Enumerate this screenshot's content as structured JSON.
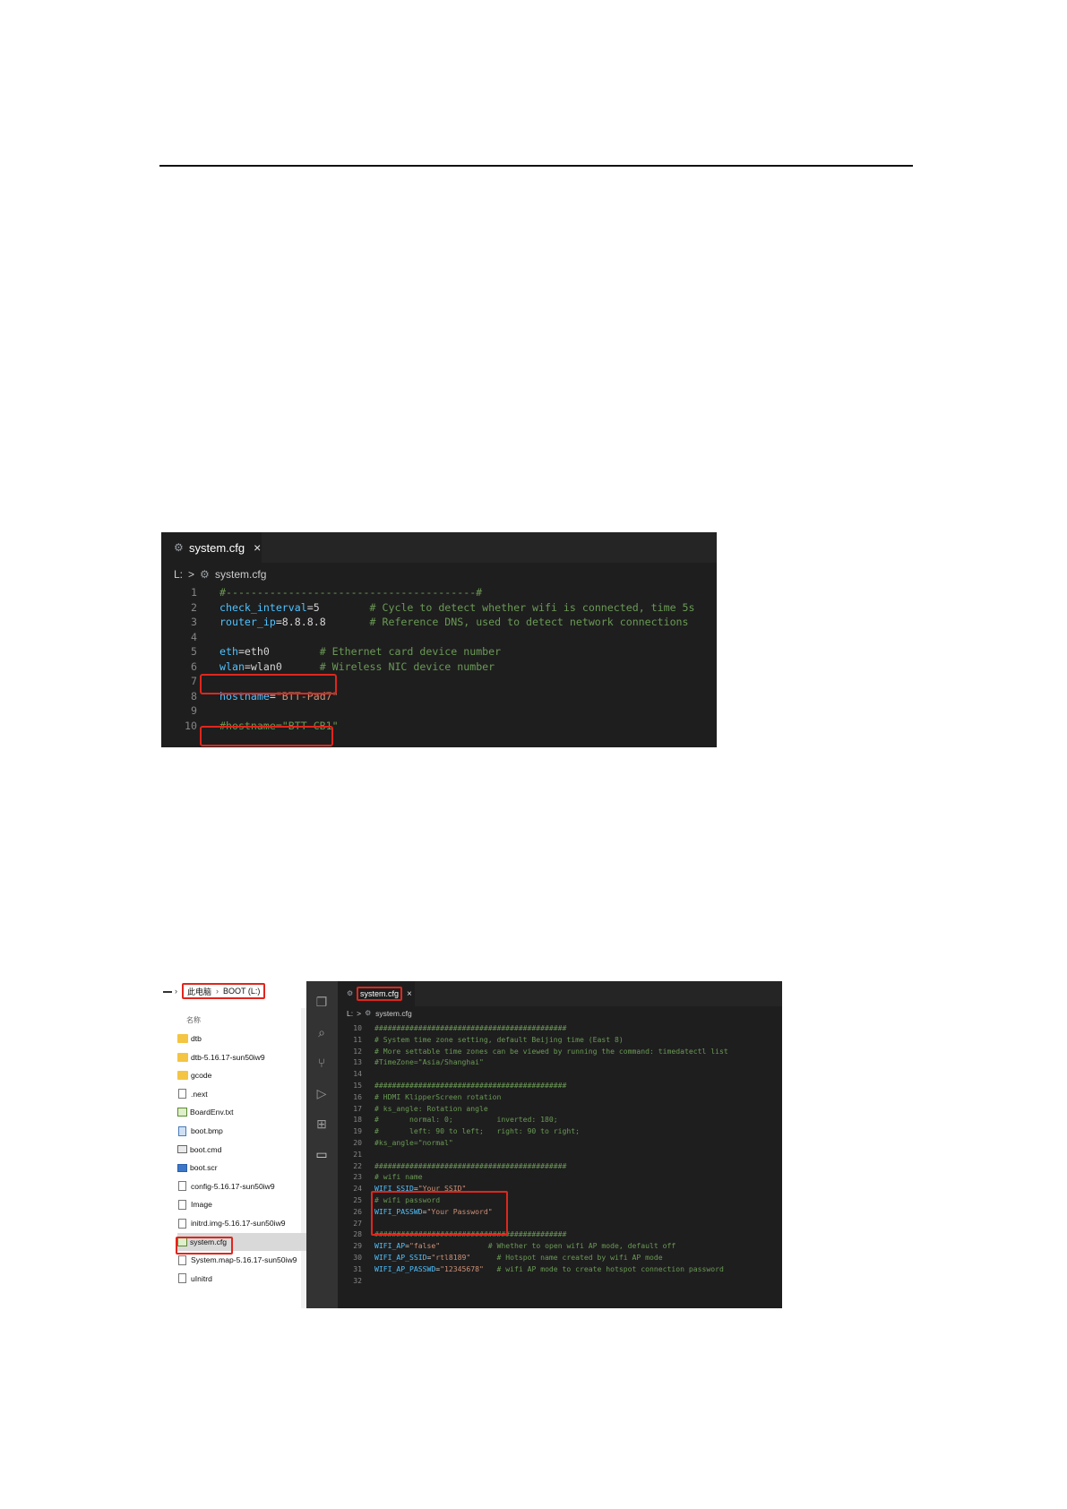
{
  "colors": {
    "editor_bg": "#1e1e1e",
    "tabbar_bg": "#252526",
    "keyword": "#4fc1ff",
    "comment": "#6a9955",
    "string": "#ce9178",
    "highlight_box": "#e0261d"
  },
  "shot1": {
    "tab": {
      "icon": "gear-icon",
      "label": "system.cfg",
      "close": "×"
    },
    "breadcrumb": {
      "root": "L:",
      "sep": ">",
      "file": "system.cfg"
    },
    "lines": [
      {
        "n": "1",
        "parts": [
          {
            "t": "#----------------------------------------#",
            "c": "c"
          }
        ]
      },
      {
        "n": "2",
        "parts": [
          {
            "t": "check_interval",
            "c": "k"
          },
          {
            "t": "=5        ",
            "c": "v"
          },
          {
            "t": "# Cycle to detect whether wifi is connected, time 5s",
            "c": "c"
          }
        ]
      },
      {
        "n": "3",
        "parts": [
          {
            "t": "router_ip",
            "c": "k"
          },
          {
            "t": "=8.8.8.8       ",
            "c": "v"
          },
          {
            "t": "# Reference DNS, used to detect network connections",
            "c": "c"
          }
        ]
      },
      {
        "n": "4",
        "parts": []
      },
      {
        "n": "5",
        "parts": [
          {
            "t": "eth",
            "c": "k"
          },
          {
            "t": "=eth0        ",
            "c": "v"
          },
          {
            "t": "# Ethernet card device number",
            "c": "c"
          }
        ]
      },
      {
        "n": "6",
        "parts": [
          {
            "t": "wlan",
            "c": "k"
          },
          {
            "t": "=wlan0      ",
            "c": "v"
          },
          {
            "t": "# Wireless NIC device number",
            "c": "c"
          }
        ]
      },
      {
        "n": "7",
        "parts": []
      },
      {
        "n": "8",
        "parts": [
          {
            "t": "hostname",
            "c": "k"
          },
          {
            "t": "=",
            "c": "v"
          },
          {
            "t": "\"BTT-Pad7\"",
            "c": "s"
          }
        ]
      },
      {
        "n": "9",
        "parts": []
      },
      {
        "n": "10",
        "parts": [
          {
            "t": "#hostname=\"BTT-CB1\"",
            "c": "c"
          }
        ]
      }
    ]
  },
  "shot2": {
    "explorer": {
      "path": {
        "root": "此电脑",
        "sep": "›",
        "drive": "BOOT (L:)"
      },
      "column_header": "名称",
      "items": [
        {
          "name": "dtb",
          "icon": "folder-icon",
          "kind": "folder"
        },
        {
          "name": "dtb-5.16.17-sun50iw9",
          "icon": "folder-icon",
          "kind": "folder"
        },
        {
          "name": "gcode",
          "icon": "folder-icon",
          "kind": "folder"
        },
        {
          "name": ".next",
          "icon": "file-icon",
          "kind": "file"
        },
        {
          "name": "BoardEnv.txt",
          "icon": "text-file-icon",
          "kind": "txt"
        },
        {
          "name": "boot.bmp",
          "icon": "image-file-icon",
          "kind": "img"
        },
        {
          "name": "boot.cmd",
          "icon": "command-file-icon",
          "kind": "cmd"
        },
        {
          "name": "boot.scr",
          "icon": "script-file-icon",
          "kind": "scr"
        },
        {
          "name": "config-5.16.17-sun50iw9",
          "icon": "file-icon",
          "kind": "file"
        },
        {
          "name": "Image",
          "icon": "file-icon",
          "kind": "file"
        },
        {
          "name": "initrd.img-5.16.17-sun50iw9",
          "icon": "file-icon",
          "kind": "file"
        },
        {
          "name": "system.cfg",
          "icon": "text-file-icon",
          "kind": "txt",
          "selected": true
        },
        {
          "name": "System.map-5.16.17-sun50iw9",
          "icon": "file-icon",
          "kind": "file"
        },
        {
          "name": "uInitrd",
          "icon": "file-icon",
          "kind": "file"
        }
      ]
    },
    "activity_bar": [
      "explorer-icon",
      "search-icon",
      "source-control-icon",
      "run-debug-icon",
      "extensions-icon",
      "remote-explorer-icon"
    ],
    "tab": {
      "icon": "gear-icon",
      "label": "system.cfg",
      "close": "×"
    },
    "breadcrumb": {
      "root": "L:",
      "sep": ">",
      "file": "system.cfg"
    },
    "lines": [
      {
        "n": "10",
        "parts": [
          {
            "t": "############################################",
            "c": "c"
          }
        ]
      },
      {
        "n": "11",
        "parts": [
          {
            "t": "# System time zone setting, default Beijing time (East 8)",
            "c": "c"
          }
        ]
      },
      {
        "n": "12",
        "parts": [
          {
            "t": "# More settable time zones can be viewed by running the command: timedatectl list",
            "c": "c"
          }
        ]
      },
      {
        "n": "13",
        "parts": [
          {
            "t": "#TimeZone=\"Asia/Shanghai\"",
            "c": "c"
          }
        ]
      },
      {
        "n": "14",
        "parts": []
      },
      {
        "n": "15",
        "parts": [
          {
            "t": "############################################",
            "c": "c"
          }
        ]
      },
      {
        "n": "16",
        "parts": [
          {
            "t": "# HDMI KlipperScreen rotation",
            "c": "c"
          }
        ]
      },
      {
        "n": "17",
        "parts": [
          {
            "t": "# ks_angle: Rotation angle",
            "c": "c"
          }
        ]
      },
      {
        "n": "18",
        "parts": [
          {
            "t": "#       normal: 0;          inverted: 180;",
            "c": "c"
          }
        ]
      },
      {
        "n": "19",
        "parts": [
          {
            "t": "#       left: 90 to left;   right: 90 to right;",
            "c": "c"
          }
        ]
      },
      {
        "n": "20",
        "parts": [
          {
            "t": "#ks_angle=\"normal\"",
            "c": "c"
          }
        ]
      },
      {
        "n": "21",
        "parts": []
      },
      {
        "n": "22",
        "parts": [
          {
            "t": "############################################",
            "c": "c"
          }
        ]
      },
      {
        "n": "23",
        "parts": [
          {
            "t": "# wifi name",
            "c": "c"
          }
        ]
      },
      {
        "n": "24",
        "parts": [
          {
            "t": "WIFI_SSID",
            "c": "k"
          },
          {
            "t": "=",
            "c": "v"
          },
          {
            "t": "\"Your SSID\"",
            "c": "s"
          }
        ]
      },
      {
        "n": "25",
        "parts": [
          {
            "t": "# wifi password",
            "c": "c"
          }
        ]
      },
      {
        "n": "26",
        "parts": [
          {
            "t": "WIFI_PASSWD",
            "c": "k"
          },
          {
            "t": "=",
            "c": "v"
          },
          {
            "t": "\"Your Password\"",
            "c": "s"
          }
        ]
      },
      {
        "n": "27",
        "parts": []
      },
      {
        "n": "28",
        "parts": [
          {
            "t": "############################################",
            "c": "c"
          }
        ]
      },
      {
        "n": "29",
        "parts": [
          {
            "t": "WIFI_AP",
            "c": "k"
          },
          {
            "t": "=",
            "c": "v"
          },
          {
            "t": "\"false\"",
            "c": "s"
          },
          {
            "t": "           # Whether to open wifi AP mode, default off",
            "c": "c"
          }
        ]
      },
      {
        "n": "30",
        "parts": [
          {
            "t": "WIFI_AP_SSID",
            "c": "k"
          },
          {
            "t": "=",
            "c": "v"
          },
          {
            "t": "\"rtl8189\"",
            "c": "s"
          },
          {
            "t": "      # Hotspot name created by wifi AP mode",
            "c": "c"
          }
        ]
      },
      {
        "n": "31",
        "parts": [
          {
            "t": "WIFI_AP_PASSWD",
            "c": "k"
          },
          {
            "t": "=",
            "c": "v"
          },
          {
            "t": "\"12345678\"",
            "c": "s"
          },
          {
            "t": "   # wifi AP mode to create hotspot connection password",
            "c": "c"
          }
        ]
      },
      {
        "n": "32",
        "parts": []
      }
    ]
  }
}
